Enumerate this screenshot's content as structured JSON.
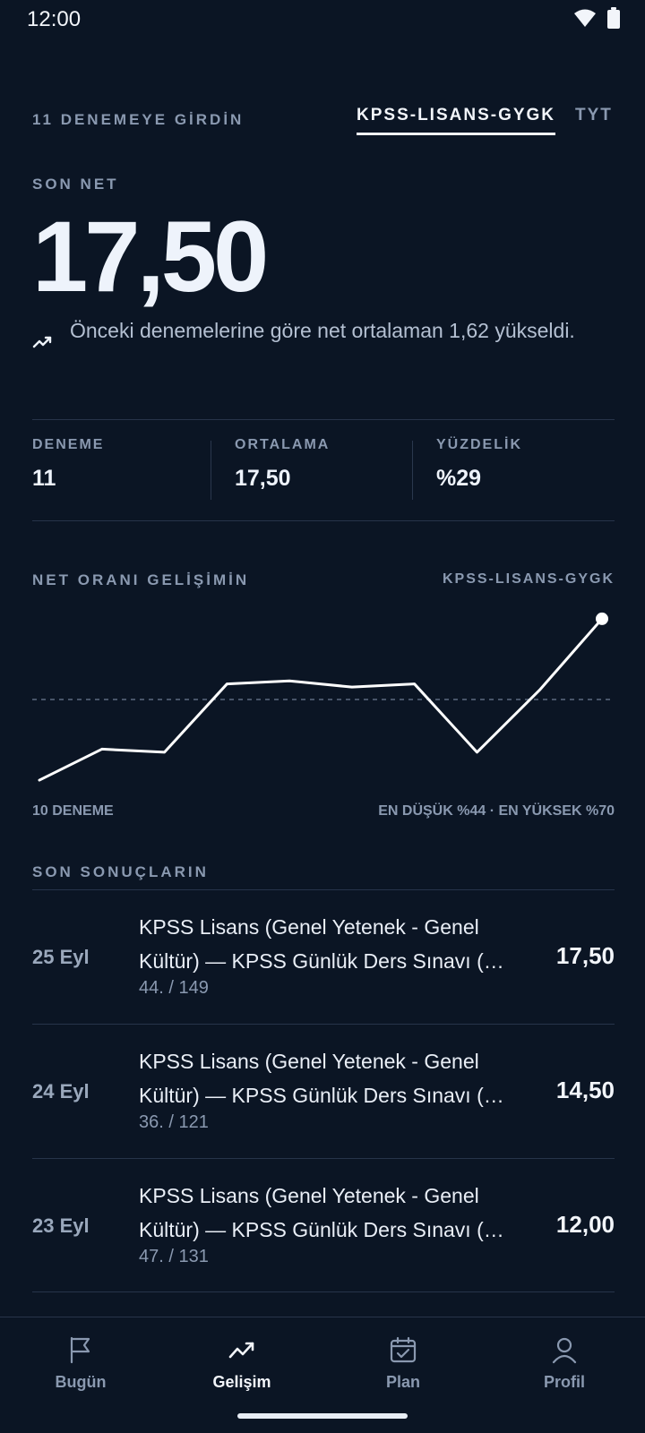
{
  "status_bar": {
    "time": "12:00",
    "icons": [
      "wifi-icon",
      "battery-icon"
    ]
  },
  "header": {
    "attempts_label": "11 DENEMEYE GİRDİN",
    "tabs": [
      {
        "label": "KPSS-LISANS-GYGK",
        "active": true
      },
      {
        "label": "TYT",
        "active": false
      }
    ]
  },
  "summary": {
    "son_net_label": "SON NET",
    "son_net_value": "17,50",
    "trend_text": "Önceki denemelerine göre net ortalaman 1,62 yükseldi."
  },
  "stats": [
    {
      "label": "DENEME",
      "value": "11"
    },
    {
      "label": "ORTALAMA",
      "value": "17,50"
    },
    {
      "label": "YÜZDELİK",
      "value": "%29"
    }
  ],
  "chart_section": {
    "title": "NET ORANI GELİŞİMİN",
    "exam": "KPSS-LISANS-GYGK",
    "footer_left": "10 DENEME",
    "footer_right": "EN DÜŞÜK %44 · EN YÜKSEK %70"
  },
  "chart_data": {
    "type": "line",
    "series": [
      {
        "values": [
          44,
          49,
          48.5,
          59.5,
          60,
          59,
          59.5,
          48.5,
          58.5,
          70
        ]
      }
    ],
    "ylim": [
      43,
      71
    ],
    "reference_line": 57,
    "grid": false,
    "line_color": "#ffffff",
    "reference_color": "#5d6b80"
  },
  "results_section": {
    "title": "SON SONUÇLARIN",
    "items": [
      {
        "date": "25 Eyl",
        "title": "KPSS Lisans (Genel Yetenek - Genel Kültür) — KPSS Günlük Ders Sınavı (…",
        "rank": "44. / 149",
        "net": "17,50"
      },
      {
        "date": "24 Eyl",
        "title": "KPSS Lisans (Genel Yetenek - Genel Kültür) — KPSS Günlük Ders Sınavı (…",
        "rank": "36. / 121",
        "net": "14,50"
      },
      {
        "date": "23 Eyl",
        "title": "KPSS Lisans (Genel Yetenek - Genel Kültür) — KPSS Günlük Ders Sınavı (…",
        "rank": "47. / 131",
        "net": "12,00"
      }
    ]
  },
  "bottom_nav": [
    {
      "label": "Bugün",
      "icon": "flag-icon",
      "active": false
    },
    {
      "label": "Gelişim",
      "icon": "trend-up-icon",
      "active": true
    },
    {
      "label": "Plan",
      "icon": "calendar-check-icon",
      "active": false
    },
    {
      "label": "Profil",
      "icon": "person-icon",
      "active": false
    }
  ],
  "colors": {
    "background": "#0b1524",
    "text": "#eef2f8",
    "muted": "#8a99b0",
    "divider": "#27344a"
  }
}
